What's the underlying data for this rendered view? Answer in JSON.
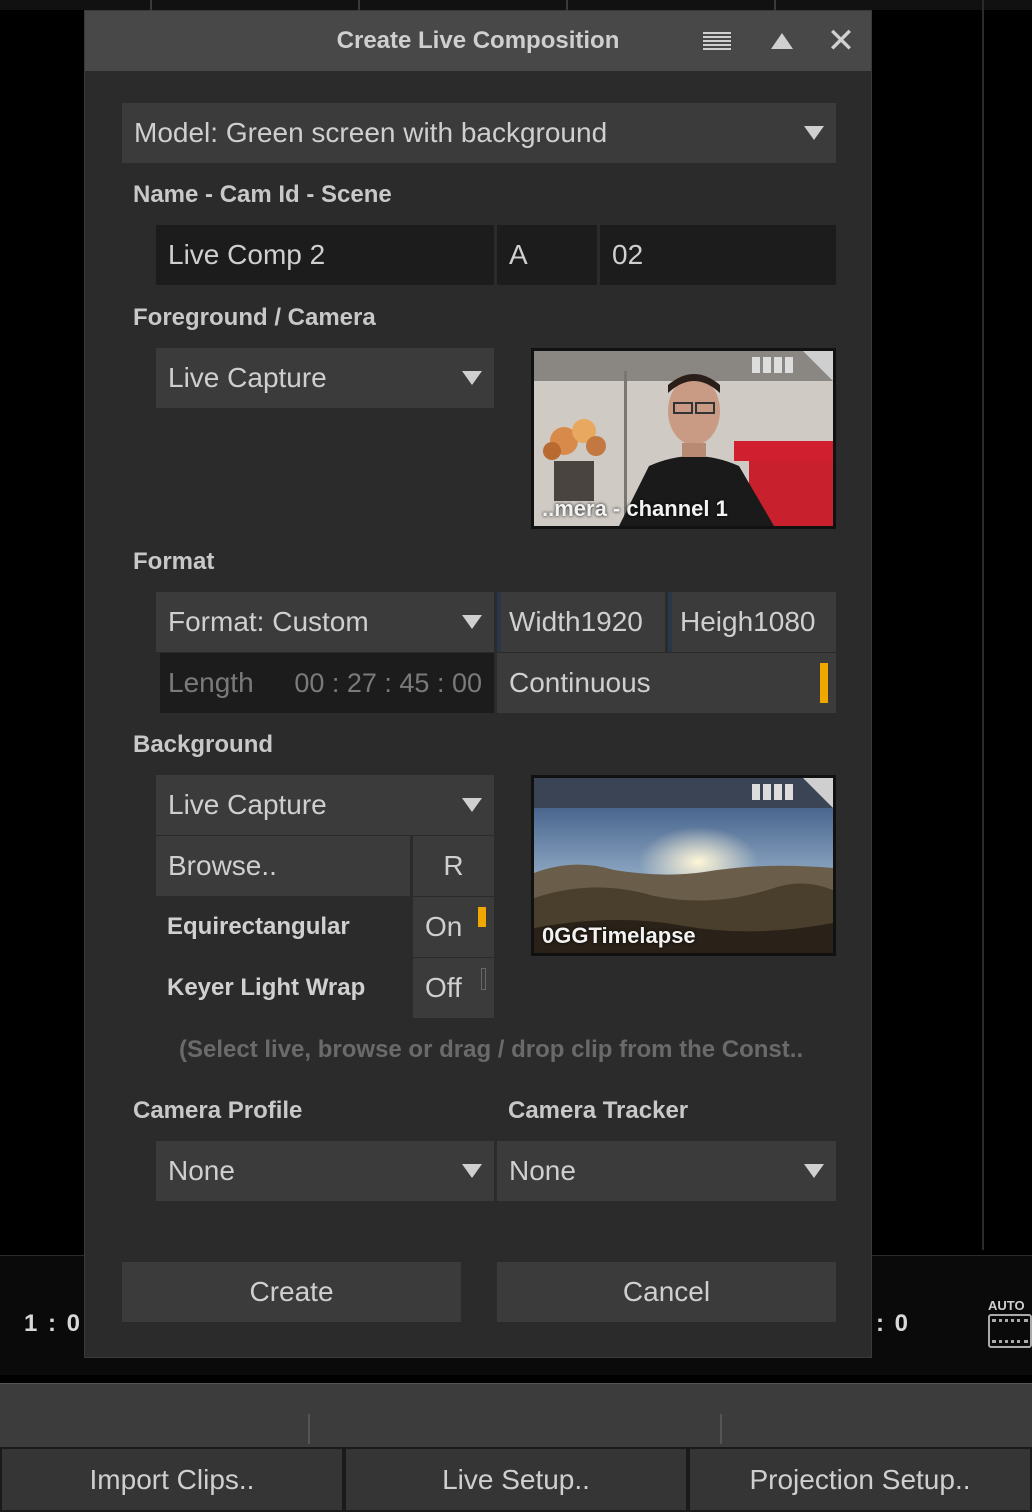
{
  "dialog": {
    "title": "Create Live Composition",
    "model_select": "Model: Green screen with background",
    "name_section_label": "Name - Cam Id - Scene",
    "name_value": "Live Comp 2",
    "cam_id_value": "A",
    "scene_value": "02",
    "foreground_label": "Foreground / Camera",
    "foreground_source": "Live Capture",
    "foreground_thumb_caption": "..mera - channel 1",
    "format_label": "Format",
    "format_select": "Format: Custom",
    "width_label": "Width",
    "width_value": "1920",
    "height_label": "Heigh",
    "height_value": "1080",
    "length_label": "Length",
    "length_value": "00 : 27 : 45 : 00",
    "continuous_label": "Continuous",
    "background_label": "Background",
    "background_source": "Live Capture",
    "browse_label": "Browse..",
    "r_label": "R",
    "background_thumb_caption": "0GGTimelapse",
    "equirect_label": "Equirectangular",
    "equirect_value": "On",
    "lightwrap_label": "Keyer Light Wrap",
    "lightwrap_value": "Off",
    "hint_text": "(Select live, browse or drag / drop clip from the Const..",
    "camera_profile_label": "Camera Profile",
    "camera_profile_value": "None",
    "camera_tracker_label": "Camera Tracker",
    "camera_tracker_value": "None",
    "create_label": "Create",
    "cancel_label": "Cancel"
  },
  "background_app": {
    "timecode_left": "1 : 0",
    "timecode_right": ": 0",
    "auto_label": "AUTO",
    "bottom_buttons": [
      "Import Clips..",
      "Live Setup..",
      "Projection Setup.."
    ]
  },
  "colors": {
    "accent": "#f0a800",
    "dialog_bg": "#2b2b2b",
    "title_bg": "#484848",
    "field_dark": "#1c1c1c",
    "field_mid": "#3b3b3b"
  }
}
